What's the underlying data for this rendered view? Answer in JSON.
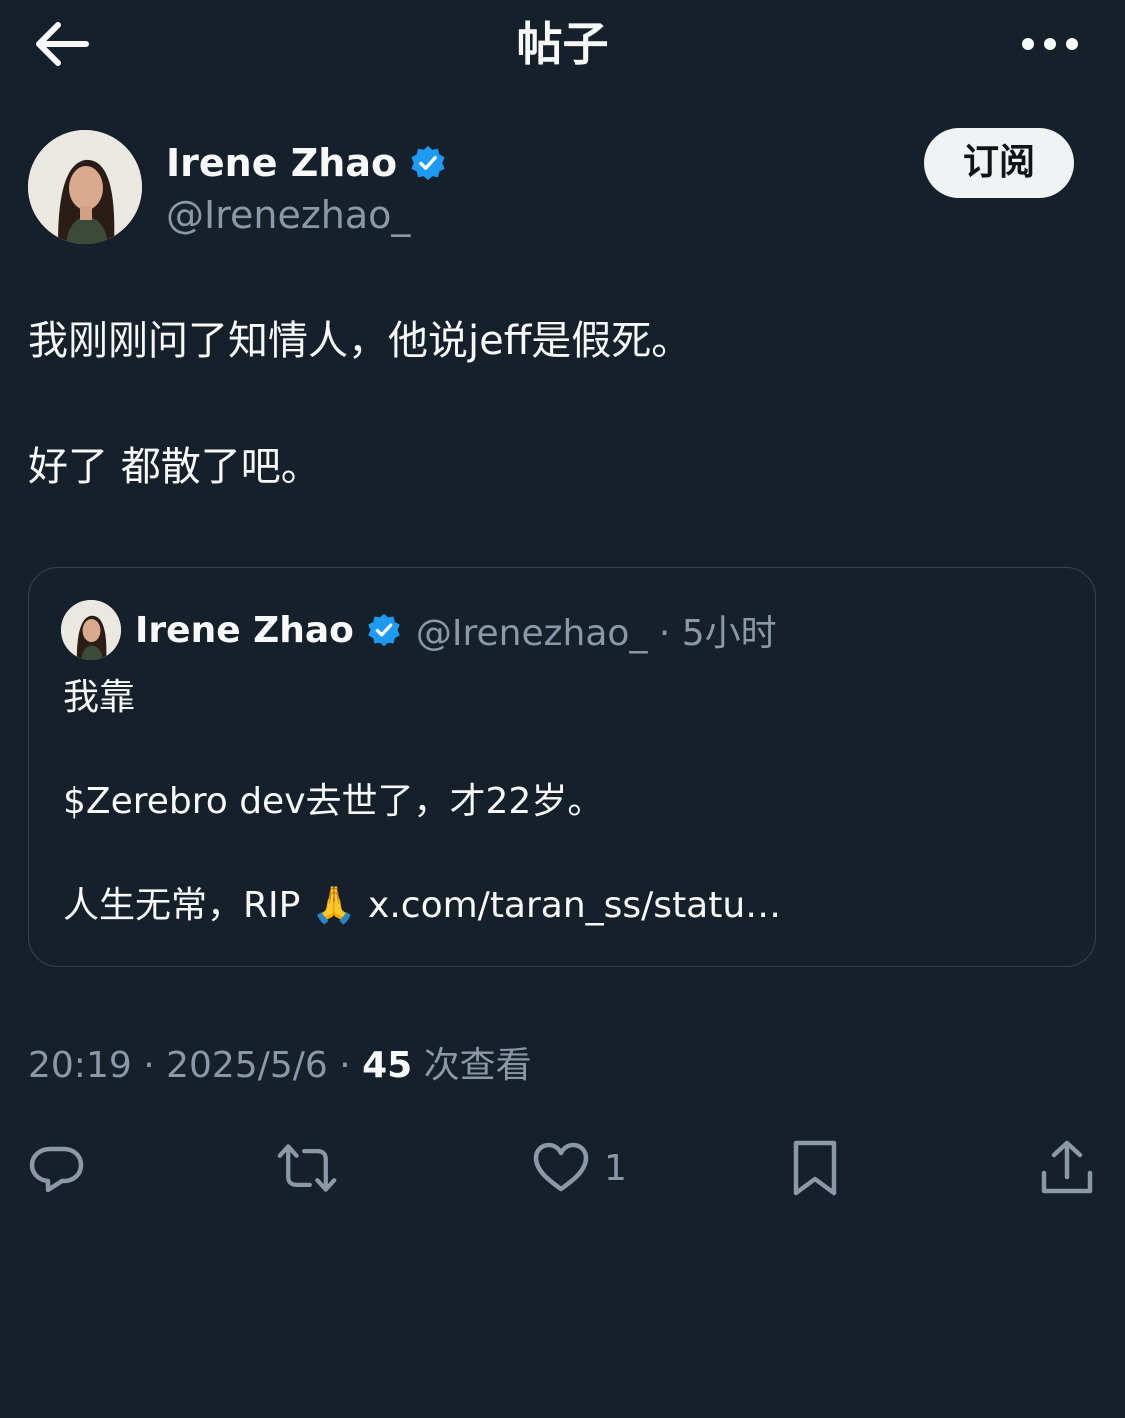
{
  "header": {
    "title": "帖子",
    "back_icon": "arrow-left-icon",
    "more_icon": "more-horizontal-icon"
  },
  "author": {
    "name": "Irene Zhao",
    "handle": "@Irenezhao_",
    "verified_icon": "verified-badge-icon",
    "subscribe_label": "订阅"
  },
  "post": {
    "lines": [
      "我刚刚问了知情人，他说jeff是假死。",
      "好了 都散了吧。"
    ]
  },
  "quoted": {
    "name": "Irene Zhao",
    "meta": "@Irenezhao_ · 5小时",
    "lines": [
      "我靠",
      "$Zerebro dev去世了，才22岁。",
      "人生无常，RIP 🙏 x.com/taran_ss/statu…"
    ]
  },
  "meta": {
    "timestamp": "20:19 · 2025/5/6 · ",
    "views_count": "45",
    "views_label": " 次查看"
  },
  "actions": {
    "reply_icon": "reply-icon",
    "repost_icon": "repost-icon",
    "like_icon": "heart-icon",
    "like_count": "1",
    "bookmark_icon": "bookmark-icon",
    "share_icon": "share-icon"
  },
  "colors": {
    "background": "#15202b",
    "text_primary": "#f7f9f9",
    "text_secondary": "#8b98a5",
    "verified_blue": "#1d9bf0",
    "border": "#38444d",
    "button_bg": "#eff3f4"
  }
}
